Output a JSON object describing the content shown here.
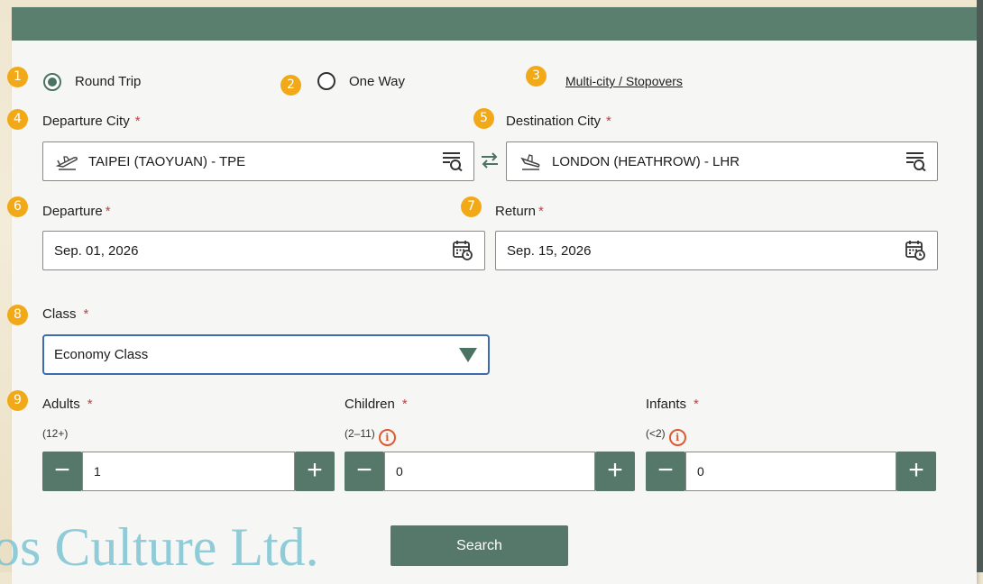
{
  "trip_type": {
    "round_trip": {
      "badge": "1",
      "label": "Round Trip",
      "selected": true
    },
    "one_way": {
      "badge": "2",
      "label": "One Way",
      "selected": false
    },
    "multi_city": {
      "badge": "3",
      "label": "Multi-city / Stopovers"
    }
  },
  "departure_city": {
    "badge": "4",
    "label": "Departure City",
    "required": "*",
    "value": "TAIPEI (TAOYUAN) - TPE"
  },
  "destination_city": {
    "badge": "5",
    "label": "Destination City",
    "required": "*",
    "value": "LONDON (HEATHROW) - LHR"
  },
  "departure_date": {
    "badge": "6",
    "label": "Departure",
    "required": "*",
    "value": "Sep. 01, 2026"
  },
  "return_date": {
    "badge": "7",
    "label": "Return",
    "required": "*",
    "value": "Sep. 15, 2026"
  },
  "cabin_class": {
    "badge": "8",
    "label": "Class",
    "required": "*",
    "value": "Economy Class"
  },
  "passengers": {
    "badge": "9",
    "adults": {
      "label": "Adults",
      "required": "*",
      "age": "(12+)",
      "value": "1"
    },
    "children": {
      "label": "Children",
      "required": "*",
      "age": "(2–11)",
      "value": "0"
    },
    "infants": {
      "label": "Infants",
      "required": "*",
      "age": "(<2)",
      "value": "0"
    },
    "minus": "−",
    "plus": "+",
    "info_glyph": "i"
  },
  "search_button": "Search",
  "watermark": "os Culture Ltd.",
  "colors": {
    "accent": "#55786a",
    "badge": "#f2a917",
    "required": "#d6383a",
    "focus": "#3e6ab0",
    "info": "#e2572b"
  }
}
